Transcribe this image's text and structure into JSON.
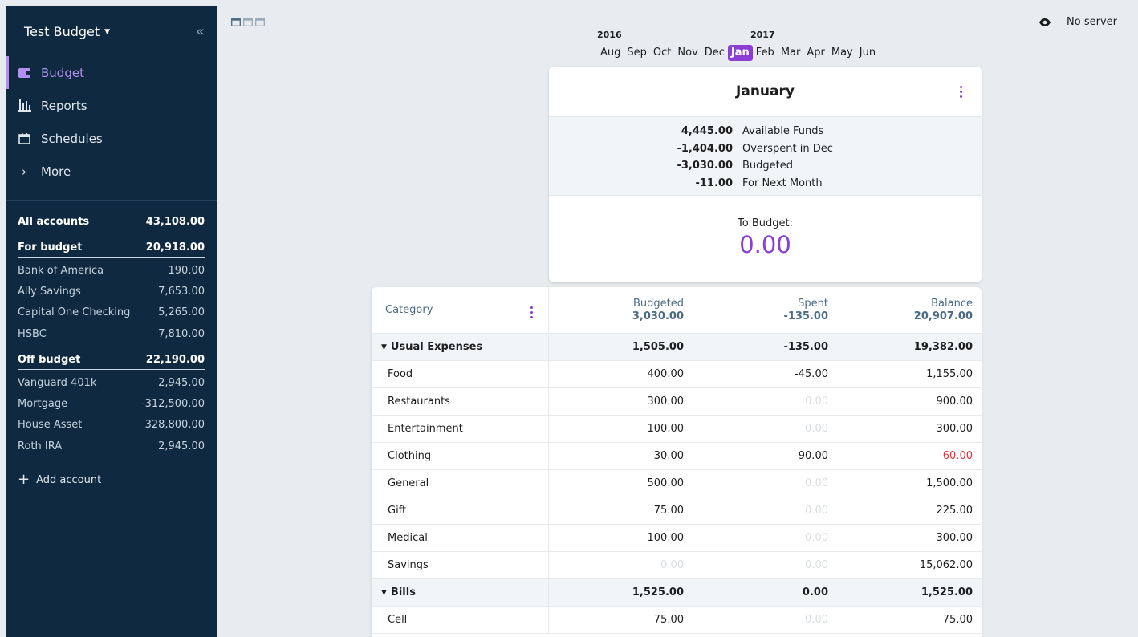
{
  "sidebar": {
    "budget_name": "Test Budget",
    "nav": [
      {
        "label": "Budget",
        "icon": "wallet-icon",
        "active": true
      },
      {
        "label": "Reports",
        "icon": "bar-chart-icon",
        "active": false
      },
      {
        "label": "Schedules",
        "icon": "calendar-icon",
        "active": false
      },
      {
        "label": "More",
        "icon": "chevron-right-icon",
        "active": false
      }
    ],
    "all_accounts": {
      "label": "All accounts",
      "value": "43,108.00"
    },
    "for_budget": {
      "label": "For budget",
      "value": "20,918.00",
      "accounts": [
        {
          "name": "Bank of America",
          "value": "190.00"
        },
        {
          "name": "Ally Savings",
          "value": "7,653.00"
        },
        {
          "name": "Capital One Checking",
          "value": "5,265.00"
        },
        {
          "name": "HSBC",
          "value": "7,810.00"
        }
      ]
    },
    "off_budget": {
      "label": "Off budget",
      "value": "22,190.00",
      "accounts": [
        {
          "name": "Vanguard 401k",
          "value": "2,945.00"
        },
        {
          "name": "Mortgage",
          "value": "-312,500.00"
        },
        {
          "name": "House Asset",
          "value": "328,800.00"
        },
        {
          "name": "Roth IRA",
          "value": "2,945.00"
        }
      ]
    },
    "add_account": "Add account"
  },
  "topbar": {
    "server_status": "No server"
  },
  "month_picker": {
    "years": [
      "2016",
      "2017"
    ],
    "months": [
      "Aug",
      "Sep",
      "Oct",
      "Nov",
      "Dec",
      "Jan",
      "Feb",
      "Mar",
      "Apr",
      "May",
      "Jun"
    ],
    "selected": "Jan"
  },
  "summary": {
    "title": "January",
    "lines": [
      {
        "value": "4,445.00",
        "label": "Available Funds"
      },
      {
        "value": "-1,404.00",
        "label": "Overspent in Dec"
      },
      {
        "value": "-3,030.00",
        "label": "Budgeted"
      },
      {
        "value": "-11.00",
        "label": "For Next Month"
      }
    ],
    "to_budget_label": "To Budget:",
    "to_budget_value": "0.00"
  },
  "table": {
    "header": {
      "category": "Category",
      "budgeted_label": "Budgeted",
      "budgeted_total": "3,030.00",
      "spent_label": "Spent",
      "spent_total": "-135.00",
      "balance_label": "Balance",
      "balance_total": "20,907.00"
    },
    "rows": [
      {
        "type": "group",
        "name": "Usual Expenses",
        "budgeted": "1,505.00",
        "spent": "-135.00",
        "balance": "19,382.00"
      },
      {
        "type": "item",
        "name": "Food",
        "budgeted": "400.00",
        "spent": "-45.00",
        "balance": "1,155.00"
      },
      {
        "type": "item",
        "name": "Restaurants",
        "budgeted": "300.00",
        "spent": "0.00",
        "balance": "900.00"
      },
      {
        "type": "item",
        "name": "Entertainment",
        "budgeted": "100.00",
        "spent": "0.00",
        "balance": "300.00"
      },
      {
        "type": "item",
        "name": "Clothing",
        "budgeted": "30.00",
        "spent": "-90.00",
        "balance": "-60.00"
      },
      {
        "type": "item",
        "name": "General",
        "budgeted": "500.00",
        "spent": "0.00",
        "balance": "1,500.00"
      },
      {
        "type": "item",
        "name": "Gift",
        "budgeted": "75.00",
        "spent": "0.00",
        "balance": "225.00"
      },
      {
        "type": "item",
        "name": "Medical",
        "budgeted": "100.00",
        "spent": "0.00",
        "balance": "300.00"
      },
      {
        "type": "item",
        "name": "Savings",
        "budgeted": "0.00",
        "spent": "0.00",
        "balance": "15,062.00"
      },
      {
        "type": "group",
        "name": "Bills",
        "budgeted": "1,525.00",
        "spent": "0.00",
        "balance": "1,525.00"
      },
      {
        "type": "item",
        "name": "Cell",
        "budgeted": "75.00",
        "spent": "0.00",
        "balance": "75.00"
      }
    ]
  },
  "colors": {
    "accent": "#8b3ed6",
    "sidebar_bg": "#0f2a40",
    "negative": "#e2323a"
  }
}
